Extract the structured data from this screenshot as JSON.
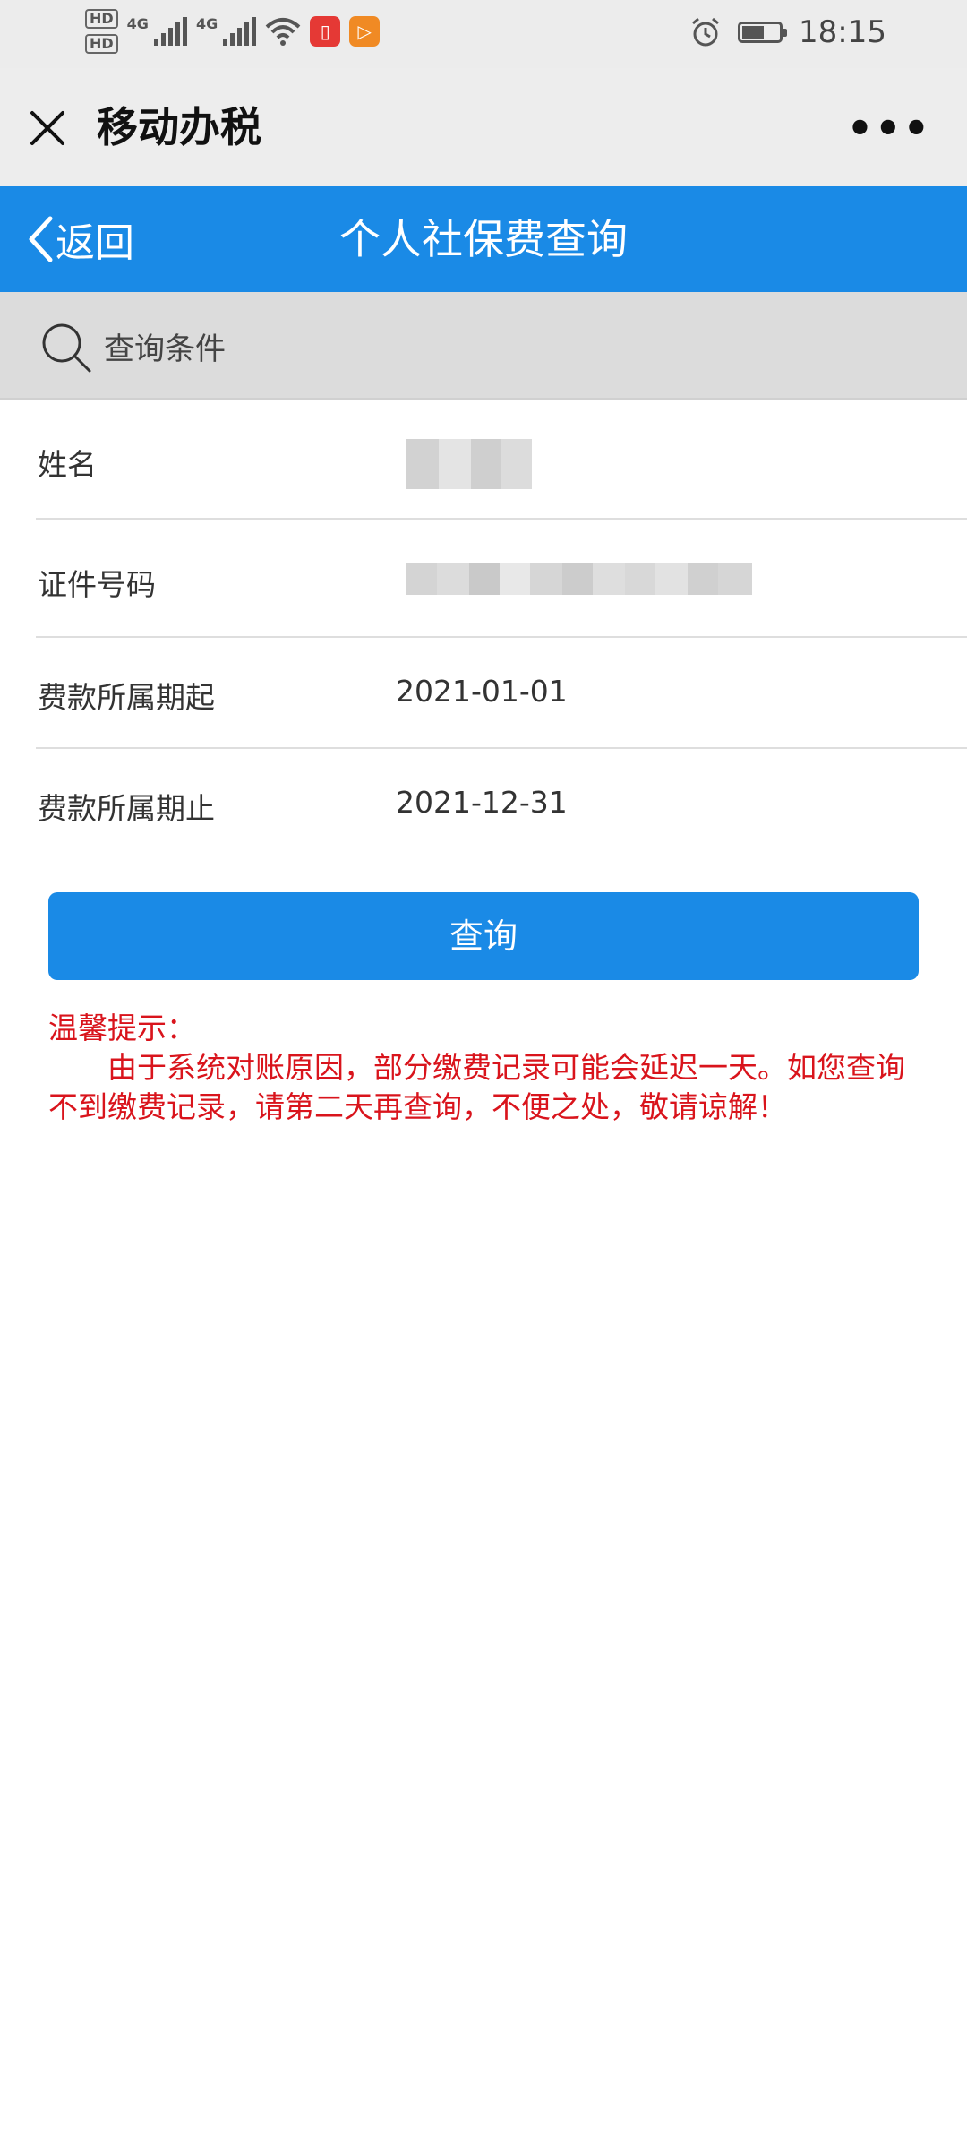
{
  "status_bar": {
    "hd1": "HD",
    "hd2": "HD",
    "net1": "4G",
    "net2": "4G",
    "time": "18:15",
    "battery_level": 0.6,
    "icons": [
      "signal-icon",
      "wifi-icon",
      "book-app-icon",
      "video-app-icon",
      "alarm-icon",
      "battery-icon"
    ]
  },
  "wechat_bar": {
    "title": "移动办税"
  },
  "nav": {
    "back_label": "返回",
    "title": "个人社保费查询"
  },
  "search": {
    "label": "查询条件"
  },
  "form": {
    "name_label": "姓名",
    "id_label": "证件号码",
    "start_label": "费款所属期起",
    "start_value": "2021-01-01",
    "end_label": "费款所属期止",
    "end_value": "2021-12-31"
  },
  "query_button": "查询",
  "tips": {
    "title": "温馨提示：",
    "body": "由于系统对账原因，部分缴费记录可能会延迟一天。如您查询不到缴费记录，请第二天再查询，不便之处，敬请谅解！"
  },
  "colors": {
    "primary": "#1a8ae6",
    "tip_text": "#d9141c",
    "status_bg": "#ececec",
    "search_bg": "#dcdcdc"
  }
}
